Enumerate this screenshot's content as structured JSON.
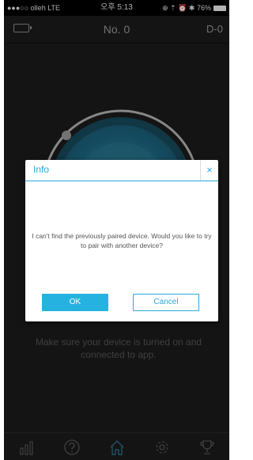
{
  "status_bar": {
    "carrier": "●●●○○ olleh  LTE",
    "time": "오후 5:13",
    "indicators": "⊕ ⇡ ⏰ ✱ 76%",
    "battery_percent": 76
  },
  "header": {
    "title": "No. 0",
    "dday": "D-0"
  },
  "main": {
    "hint": "Make sure your device is turned on and connected to app."
  },
  "dialog": {
    "title": "Info",
    "close": "×",
    "message": "I can't find the previously paired device. Would you like to try to pair with another device?",
    "ok_label": "OK",
    "cancel_label": "Cancel"
  },
  "nav": {
    "items": [
      "chart-icon",
      "help-icon",
      "home-icon",
      "settings-icon",
      "trophy-icon"
    ]
  },
  "colors": {
    "accent": "#2aa9d9",
    "button": "#26b2e0",
    "background": "#1b1b1b",
    "gauge_ring": "#b5b5b5"
  }
}
